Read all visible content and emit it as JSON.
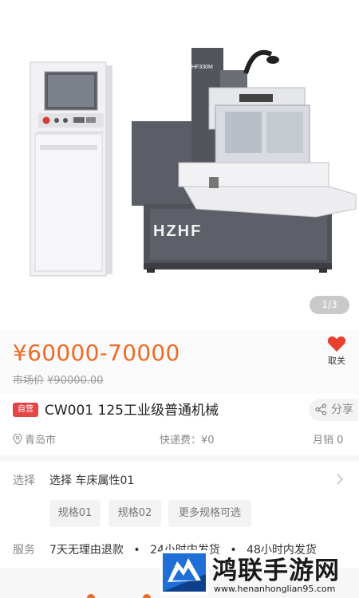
{
  "gallery": {
    "pager": "1/3",
    "brand_mark": "HZHF",
    "model_plate": "HF330M"
  },
  "price": {
    "range": "¥60000-70000",
    "market_label": "市场价",
    "market_value": "¥90000.00"
  },
  "favorite": {
    "label": "取关",
    "color": "#e8402e"
  },
  "product": {
    "self_tag": "自营",
    "title": "CW001 125工业级普通机械",
    "share_label": "分享"
  },
  "info": {
    "location": "青岛市",
    "shipping": "快递费：¥0",
    "sales": "月销 0"
  },
  "select_row": {
    "label": "选择",
    "value": "选择 车床属性01",
    "options": [
      "规格01",
      "规格02",
      "更多规格可选"
    ]
  },
  "service_row": {
    "label": "服务",
    "items": [
      "7天无理由退款",
      "24小时内发货",
      "48小时内发货"
    ]
  },
  "watermark": {
    "title": "鸿联手游网",
    "url": "www.henanhonglian95.com"
  },
  "colors": {
    "accent": "#ee6a26",
    "self_tag": "#e64545"
  }
}
